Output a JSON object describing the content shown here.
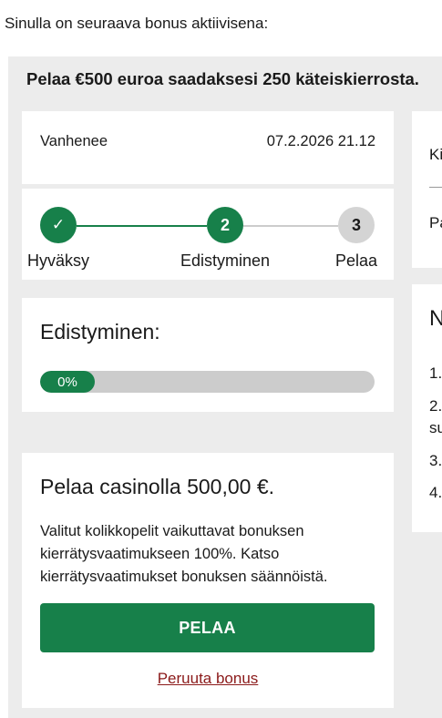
{
  "intro_text": "Sinulla on seuraava bonus aktiivisena:",
  "bonus": {
    "title": "Pelaa €500 euroa saadaksesi 250 käteiskierrosta.",
    "expiry_label": "Vanhenee",
    "expiry_value": "07.2.2026 21.12"
  },
  "steps": [
    {
      "label": "Hyväksy",
      "number": "✓",
      "state": "done"
    },
    {
      "label": "Edistyminen",
      "number": "2",
      "state": "active"
    },
    {
      "label": "Pelaa",
      "number": "3",
      "state": "pending"
    }
  ],
  "progress": {
    "heading": "Edistyminen:",
    "percent": 0,
    "percent_label": "0%"
  },
  "wager": {
    "heading": "Pelaa casinolla 500,00 €.",
    "description": "Valitut kolikkopelit vaikuttavat bonuksen kierrätysvaatimukseen 100%. Katso kierrätysvaatimukset bonuksen säännöistä.",
    "play_label": "PELAA",
    "cancel_label": "Peruuta bonus"
  },
  "side": {
    "row1": "Ki",
    "row2": "Pa",
    "heading": "N",
    "list": [
      "1.",
      "2.",
      "su",
      "3.",
      "4."
    ]
  },
  "colors": {
    "brand_green": "#17804a",
    "panel_bg": "#ececec",
    "track_gray": "#cccccc",
    "pending_gray": "#d4d4d4",
    "link_red": "#8b1a1a"
  }
}
